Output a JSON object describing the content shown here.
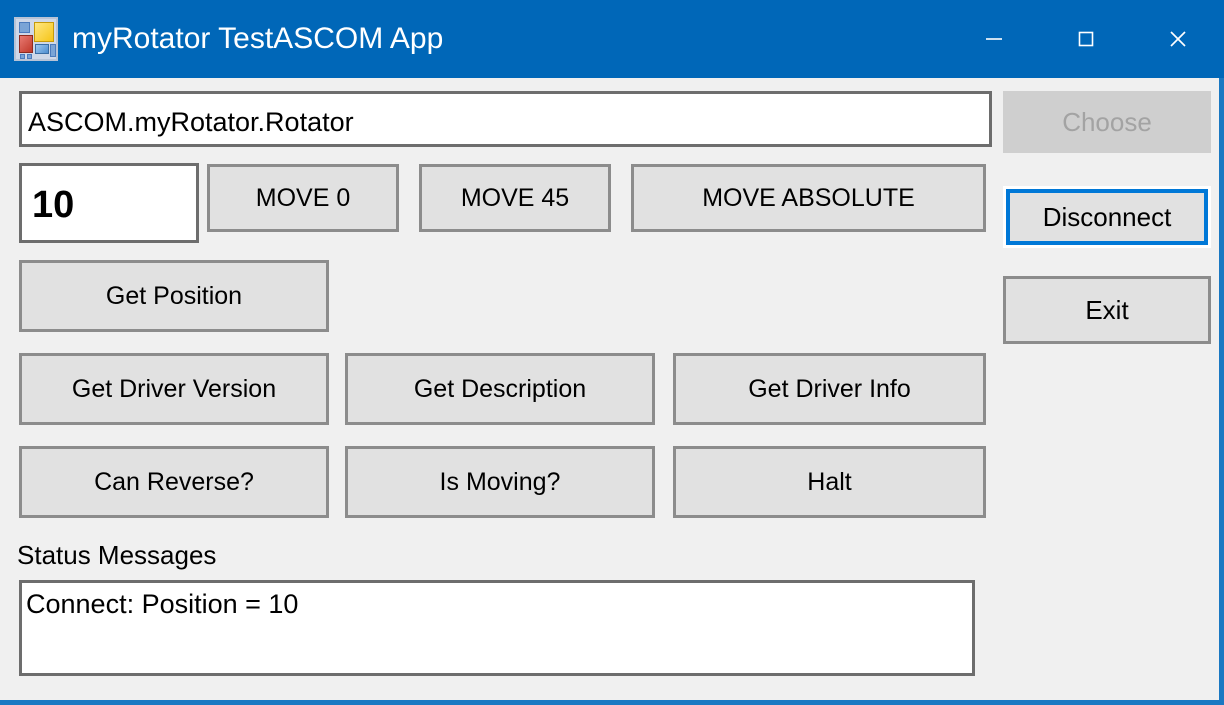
{
  "window": {
    "title": "myRotator TestASCOM App",
    "icon": "app-window-icon",
    "accent_color": "#0067b8",
    "border_color": "#1a78c2",
    "client_background": "#f0f0f0"
  },
  "titlebar_controls": [
    {
      "name": "minimize-button",
      "glyph": "minimize-icon",
      "label": "─"
    },
    {
      "name": "maximize-button",
      "glyph": "maximize-icon",
      "label": "☐"
    },
    {
      "name": "close-button",
      "glyph": "close-icon",
      "label": "✕"
    }
  ],
  "form": {
    "driver_id": {
      "value": "ASCOM.myRotator.Rotator",
      "placeholder": ""
    },
    "position": {
      "value": "10",
      "placeholder": ""
    },
    "move_buttons": [
      {
        "name": "move-0-button",
        "label": "MOVE 0"
      },
      {
        "name": "move-45-button",
        "label": "MOVE 45"
      },
      {
        "name": "move-absolute-button",
        "label": "MOVE ABSOLUTE"
      }
    ],
    "get_position_label": "Get Position",
    "info_buttons": [
      {
        "name": "get-driver-version-button",
        "label": "Get Driver Version"
      },
      {
        "name": "get-description-button",
        "label": "Get Description"
      },
      {
        "name": "get-driver-info-button",
        "label": "Get Driver Info"
      }
    ],
    "query_buttons": [
      {
        "name": "can-reverse-button",
        "label": "Can Reverse?"
      },
      {
        "name": "is-moving-button",
        "label": "Is Moving?"
      },
      {
        "name": "halt-button",
        "label": "Halt"
      }
    ],
    "side_buttons": {
      "choose": {
        "label": "Choose",
        "enabled": false
      },
      "disconnect": {
        "label": "Disconnect",
        "enabled": true,
        "focused": true,
        "focus_color": "#0078d7"
      },
      "exit": {
        "label": "Exit",
        "enabled": true
      }
    },
    "status": {
      "label": "Status Messages",
      "text": "Connect: Position = 10"
    }
  }
}
